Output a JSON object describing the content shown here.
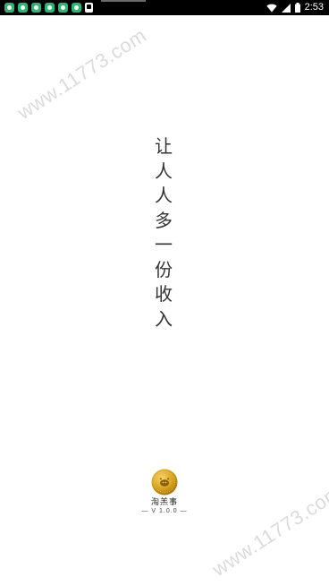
{
  "status_bar": {
    "time": "2:53",
    "notification_icons": [
      "app-notification-icon",
      "app-notification-icon",
      "app-notification-icon",
      "app-notification-icon",
      "app-notification-icon",
      "app-notification-icon",
      "download-icon"
    ],
    "system_icons": [
      "wifi-icon",
      "signal-icon",
      "battery-icon"
    ]
  },
  "watermark": {
    "text": "www.11773.com"
  },
  "splash": {
    "slogan_chars": [
      "让",
      "人",
      "人",
      "多",
      "一",
      "份",
      "收",
      "入"
    ],
    "app_name": "淘羔事",
    "version": "— V 1.0.0 —"
  },
  "colors": {
    "background": "#ffffff",
    "status_bar": "#000000",
    "logo_gold": "#d8a21a",
    "slogan_text": "#333333"
  }
}
